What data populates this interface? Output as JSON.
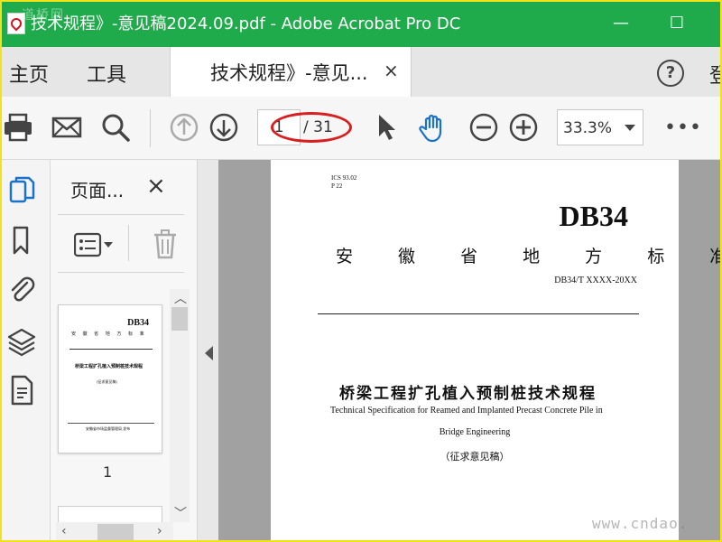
{
  "window": {
    "title": "技术规程》-意见稿2024.09.pdf - Adobe Acrobat Pro DC",
    "minimize": "—",
    "maximize": "☐",
    "corner_watermark": "道桥网"
  },
  "tabs": {
    "home": "主页",
    "tools": "工具",
    "document_tab": "技术规程》-意见...",
    "close": "×",
    "help": "?",
    "partial_right": "登"
  },
  "toolbar": {
    "current_page": "1",
    "total_pages": "/ 31",
    "zoom": "33.3%",
    "more": "•••",
    "accent_color": "#1a73c8",
    "annotation_color": "#d71f1f"
  },
  "left_strip": {
    "icons": [
      "page-thumbnails-icon",
      "bookmark-icon",
      "attachment-icon",
      "layers-icon",
      "document-icon"
    ]
  },
  "pages_panel": {
    "title": "页面...",
    "close": "×",
    "thumbnail_label": "1",
    "thumb_text": {
      "code": "DB34",
      "province": "安 徽 省 地 方 标 准",
      "title": "桥梁工程扩孔植入预制桩技术规程",
      "draft": "(征求意见稿)",
      "footer": "安徽省市场监督管理局 发布"
    }
  },
  "document": {
    "ics": "ICS 93.02",
    "classification": "P 22",
    "code": "DB34",
    "province_line": "安 徽 省 地 方 标 准",
    "standard_number": "DB34/T XXXX-20XX",
    "title_cn": "桥梁工程扩孔植入预制桩技术规程",
    "title_en_1": "Technical Specification for Reamed and Implanted Precast Concrete Pile in",
    "title_en_2": "Bridge Engineering",
    "draft": "（征求意见稿）",
    "watermark": "www.cndao."
  }
}
